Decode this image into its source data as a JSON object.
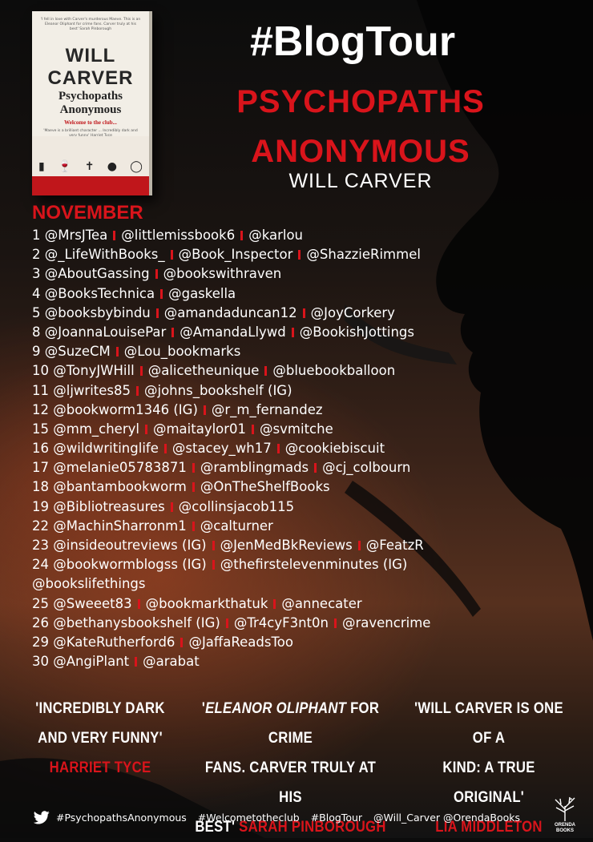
{
  "header": {
    "title": "#BlogTour",
    "book_title_line1": "PSYCHOPATHS",
    "book_title_line2": "ANONYMOUS",
    "author": "WILL CARVER"
  },
  "cover": {
    "blurb": "'I fell in love with Carver's murderous Maeve. This is an Eleanor Oliphant for crime fans. Carver truly at his best' Sarah Pinborough",
    "author": "WILL CARVER",
    "title_line1": "Psychopaths",
    "title_line2": "Anonymous",
    "tagline": "Welcome to the club...",
    "quote": "'Maeve is a brilliant character ... Incredibly dark and very funny' Harriet Tyce"
  },
  "schedule": {
    "month": "NOVEMBER",
    "rows": [
      {
        "day": "1",
        "handles": [
          "@MrsJTea",
          "@littlemissbook6",
          "@karlou"
        ]
      },
      {
        "day": "2",
        "handles": [
          "@_LifeWithBooks_",
          "@Book_Inspector",
          "@ShazzieRimmel"
        ]
      },
      {
        "day": "3",
        "handles": [
          "@AboutGassing",
          "@bookswithraven"
        ]
      },
      {
        "day": "4",
        "handles": [
          "@BooksTechnica",
          "@gaskella"
        ]
      },
      {
        "day": "5",
        "handles": [
          "@booksbybindu",
          "@amandaduncan12",
          "@JoyCorkery"
        ]
      },
      {
        "day": "8",
        "handles": [
          "@JoannaLouisePar",
          "@AmandaLlywd",
          "@BookishJottings"
        ]
      },
      {
        "day": "9",
        "handles": [
          "@SuzeCM",
          "@Lou_bookmarks"
        ]
      },
      {
        "day": "10",
        "handles": [
          "@TonyJWHill",
          "@alicetheunique",
          "@bluebookballoon"
        ]
      },
      {
        "day": "11",
        "handles": [
          "@ljwrites85",
          "@johns_bookshelf (IG)"
        ]
      },
      {
        "day": "12",
        "handles": [
          "@bookworm1346 (IG)",
          "@r_m_fernandez"
        ]
      },
      {
        "day": "15",
        "handles": [
          "@mm_cheryl",
          "@maitaylor01",
          "@svmitche"
        ]
      },
      {
        "day": "16",
        "handles": [
          "@wildwritinglife",
          "@stacey_wh17",
          "@cookiebiscuit"
        ]
      },
      {
        "day": "17",
        "handles": [
          "@melanie05783871",
          "@ramblingmads",
          "@cj_colbourn"
        ]
      },
      {
        "day": "18",
        "handles": [
          "@bantambookworm",
          "@OnTheShelfBooks"
        ]
      },
      {
        "day": "19",
        "handles": [
          "@Bibliotreasures",
          "@collinsjacob115"
        ]
      },
      {
        "day": "22",
        "handles": [
          "@MachinSharronm1",
          "@calturner"
        ]
      },
      {
        "day": "23",
        "handles": [
          "@insideoutreviews (IG)",
          "@JenMedBkReviews",
          "@FeatzR"
        ]
      },
      {
        "day": "24",
        "handles": [
          "@bookwormblogss (IG)",
          "@thefirstelevenminutes (IG)"
        ]
      },
      {
        "day": "",
        "handles": [
          "@bookslifethings"
        ]
      },
      {
        "day": "25",
        "handles": [
          "@Sweeet83",
          "@bookmarkthatuk",
          "@annecater"
        ]
      },
      {
        "day": "26",
        "handles": [
          "@bethanysbookshelf (IG)",
          "@Tr4cyF3nt0n",
          "@ravencrime"
        ]
      },
      {
        "day": "29",
        "handles": [
          "@KateRutherford6",
          "@JaffaReadsToo"
        ]
      },
      {
        "day": "30",
        "handles": [
          "@AngiPlant",
          "@arabat"
        ]
      }
    ]
  },
  "quotes": [
    {
      "text_lines": [
        "'INCREDIBLY DARK",
        "AND VERY FUNNY'"
      ],
      "source": "HARRIET TYCE"
    },
    {
      "text_lines": [
        "'ELEANOR OLIPHANT FOR CRIME",
        "FANS. CARVER TRULY AT HIS"
      ],
      "last_line": "BEST'",
      "source": "SARAH PINBOROUGH"
    },
    {
      "text_lines": [
        "'WILL CARVER IS ONE OF A",
        "KIND: A TRUE ORIGINAL'"
      ],
      "source": "LIA MIDDLETON"
    }
  ],
  "footer": {
    "hashtags": [
      "#PsychopathsAnonymous",
      "#Welcometotheclub",
      "#BlogTour",
      "@Will_Carver @OrendaBooks"
    ],
    "publisher_line1": "ORENDA",
    "publisher_line2": "BOOKS"
  },
  "colors": {
    "accent_red": "#d9141b",
    "text": "#ffffff"
  }
}
